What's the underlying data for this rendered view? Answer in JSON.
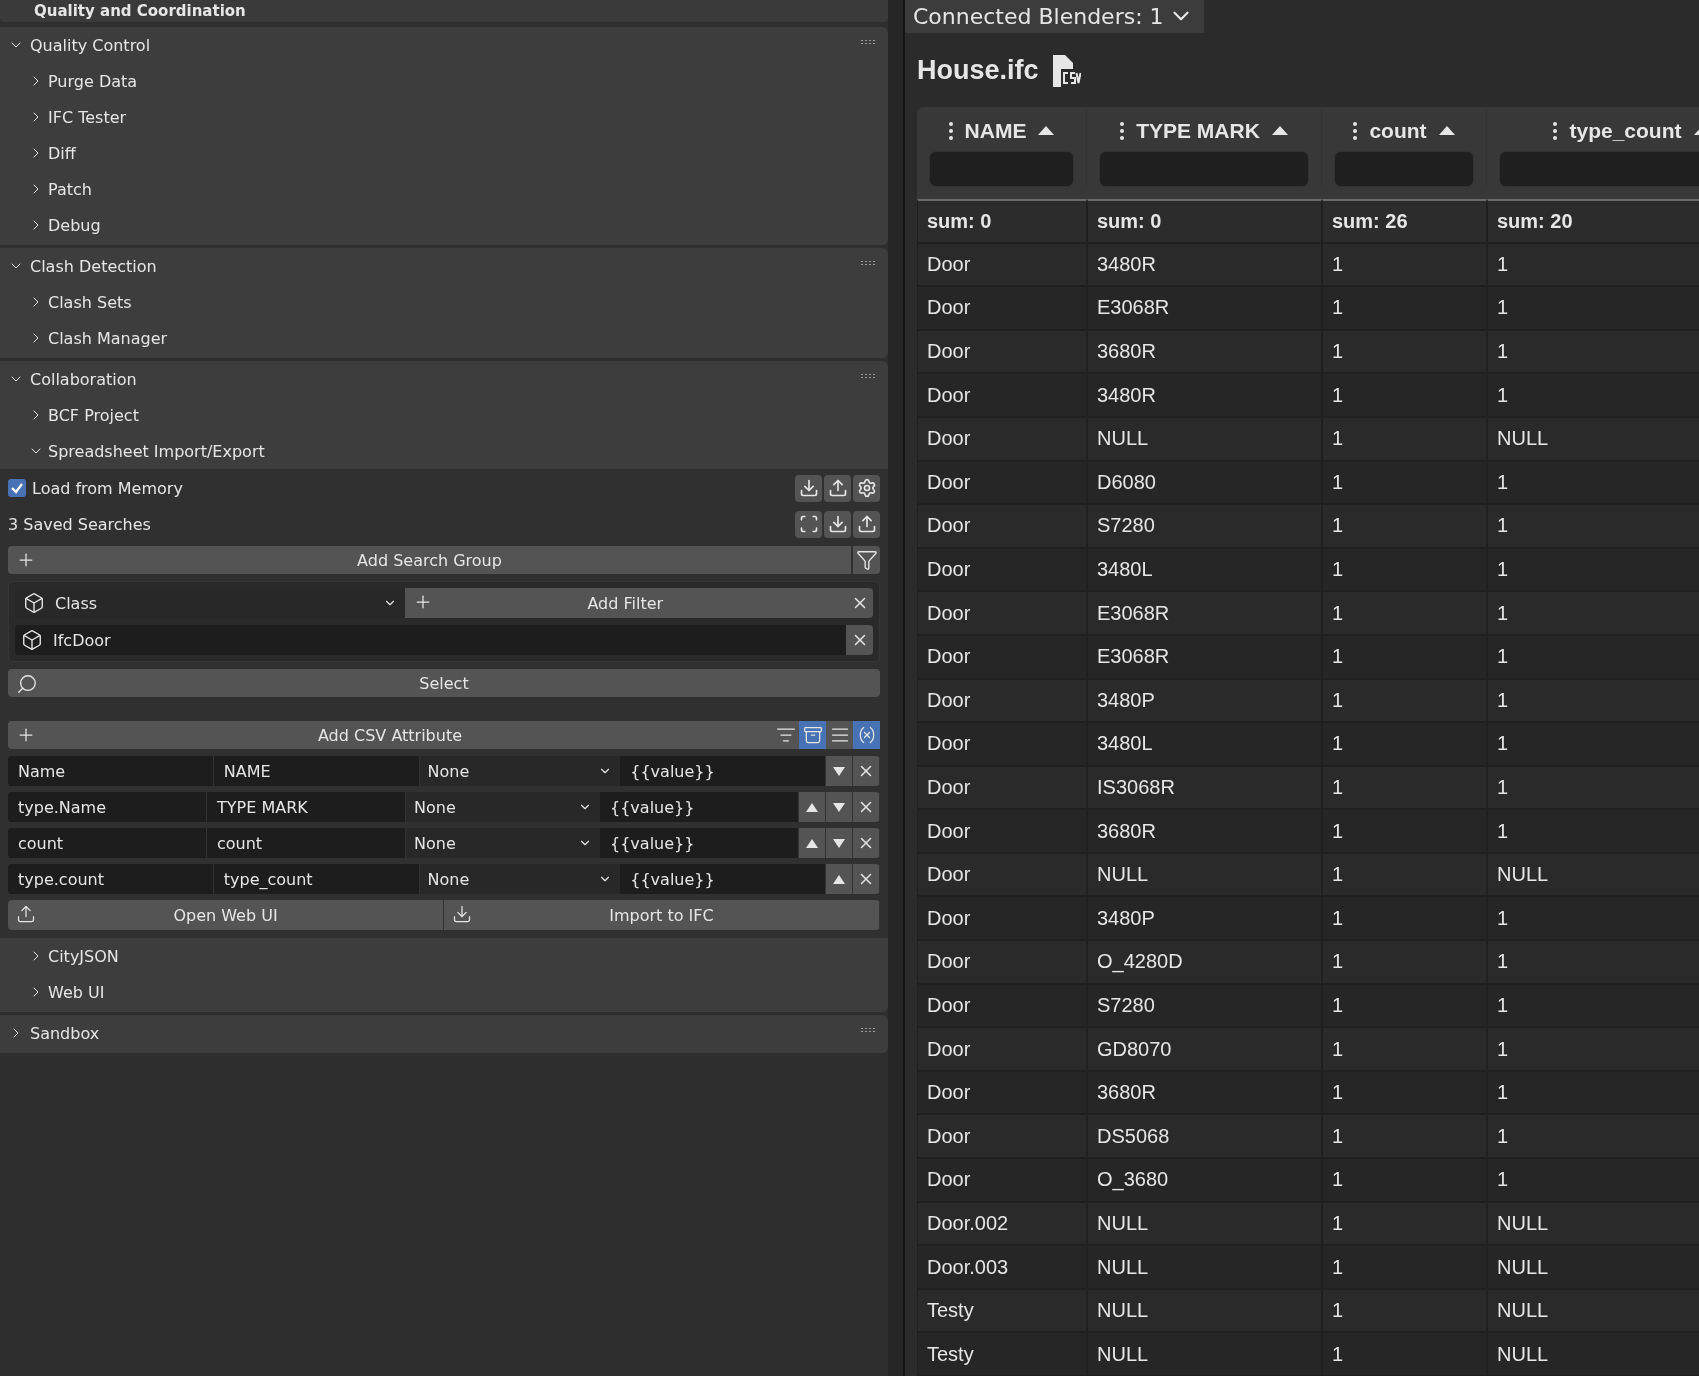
{
  "top_panel": {
    "title": "Quality and Coordination"
  },
  "panels": [
    {
      "title": "Quality Control",
      "expanded": true,
      "children": [
        {
          "label": "Purge Data",
          "expanded": false
        },
        {
          "label": "IFC Tester",
          "expanded": false
        },
        {
          "label": "Diff",
          "expanded": false
        },
        {
          "label": "Patch",
          "expanded": false
        },
        {
          "label": "Debug",
          "expanded": false
        }
      ]
    },
    {
      "title": "Clash Detection",
      "expanded": true,
      "children": [
        {
          "label": "Clash Sets",
          "expanded": false
        },
        {
          "label": "Clash Manager",
          "expanded": false
        }
      ]
    },
    {
      "title": "Collaboration",
      "expanded": true,
      "children": [
        {
          "label": "BCF Project",
          "expanded": false
        },
        {
          "label": "Spreadsheet Import/Export",
          "expanded": true
        },
        {
          "label": "CityJSON",
          "expanded": false
        },
        {
          "label": "Web UI",
          "expanded": false
        }
      ]
    },
    {
      "title": "Sandbox",
      "expanded": false
    }
  ],
  "spreadsheet": {
    "load_from_memory": {
      "label": "Load from Memory",
      "checked": true
    },
    "saved_searches": "3 Saved Searches",
    "add_search_group": "Add Search Group",
    "filter_row": {
      "class_label": "Class",
      "add_filter": "Add Filter",
      "value": "IfcDoor"
    },
    "select": "Select",
    "add_csv_attribute": "Add CSV Attribute",
    "toggles": [
      {
        "selected": false
      },
      {
        "selected": true
      },
      {
        "selected": false
      },
      {
        "selected": true
      }
    ],
    "attributes": [
      {
        "source": "Name",
        "header": "NAME",
        "format": "None",
        "template": "{{value}}",
        "can_move_up": false,
        "can_move_down": true
      },
      {
        "source": "type.Name",
        "header": "TYPE MARK",
        "format": "None",
        "template": "{{value}}",
        "can_move_up": true,
        "can_move_down": true
      },
      {
        "source": "count",
        "header": "count",
        "format": "None",
        "template": "{{value}}",
        "can_move_up": true,
        "can_move_down": true
      },
      {
        "source": "type.count",
        "header": "type_count",
        "format": "None",
        "template": "{{value}}",
        "can_move_up": true,
        "can_move_down": false
      }
    ],
    "open_web_ui": "Open Web UI",
    "import_to_ifc": "Import to IFC"
  },
  "web": {
    "connected": "Connected Blenders: 1",
    "file_title": "House.ifc",
    "columns": [
      {
        "label": "NAME",
        "sum": "sum: 0"
      },
      {
        "label": "TYPE MARK",
        "sum": "sum: 0"
      },
      {
        "label": "count",
        "sum": "sum: 26"
      },
      {
        "label": "type_count",
        "sum": "sum: 20"
      }
    ],
    "rows": [
      [
        "Door",
        "3480R",
        "1",
        "1"
      ],
      [
        "Door",
        "E3068R",
        "1",
        "1"
      ],
      [
        "Door",
        "3680R",
        "1",
        "1"
      ],
      [
        "Door",
        "3480R",
        "1",
        "1"
      ],
      [
        "Door",
        "NULL",
        "1",
        "NULL"
      ],
      [
        "Door",
        "D6080",
        "1",
        "1"
      ],
      [
        "Door",
        "S7280",
        "1",
        "1"
      ],
      [
        "Door",
        "3480L",
        "1",
        "1"
      ],
      [
        "Door",
        "E3068R",
        "1",
        "1"
      ],
      [
        "Door",
        "E3068R",
        "1",
        "1"
      ],
      [
        "Door",
        "3480P",
        "1",
        "1"
      ],
      [
        "Door",
        "3480L",
        "1",
        "1"
      ],
      [
        "Door",
        "IS3068R",
        "1",
        "1"
      ],
      [
        "Door",
        "3680R",
        "1",
        "1"
      ],
      [
        "Door",
        "NULL",
        "1",
        "NULL"
      ],
      [
        "Door",
        "3480P",
        "1",
        "1"
      ],
      [
        "Door",
        "O_4280D",
        "1",
        "1"
      ],
      [
        "Door",
        "S7280",
        "1",
        "1"
      ],
      [
        "Door",
        "GD8070",
        "1",
        "1"
      ],
      [
        "Door",
        "3680R",
        "1",
        "1"
      ],
      [
        "Door",
        "DS5068",
        "1",
        "1"
      ],
      [
        "Door",
        "O_3680",
        "1",
        "1"
      ],
      [
        "Door.002",
        "NULL",
        "1",
        "NULL"
      ],
      [
        "Door.003",
        "NULL",
        "1",
        "NULL"
      ],
      [
        "Testy",
        "NULL",
        "1",
        "NULL"
      ],
      [
        "Testy",
        "NULL",
        "1",
        "NULL"
      ]
    ]
  }
}
